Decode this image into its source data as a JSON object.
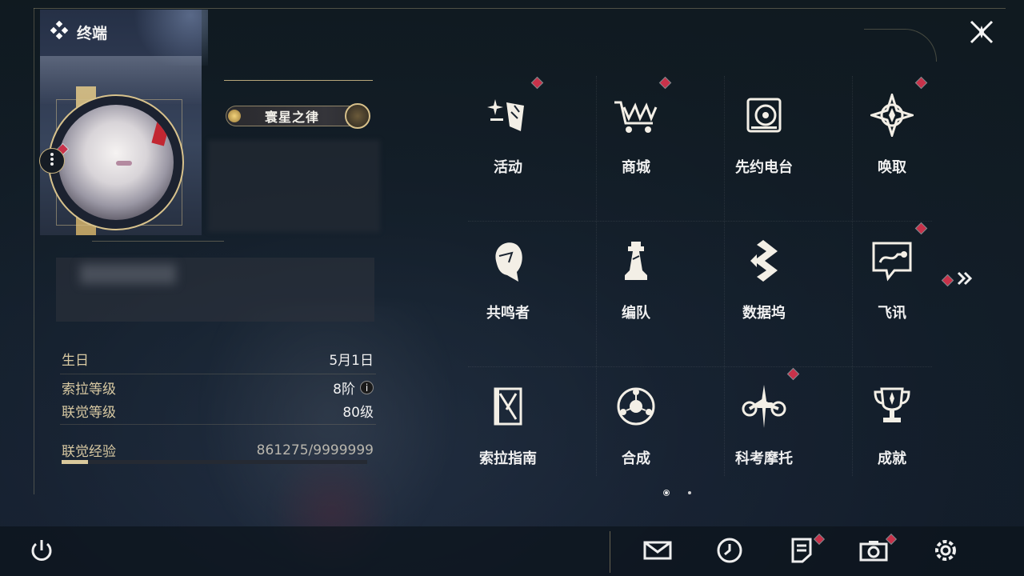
{
  "header": {
    "title": "终端",
    "title_icon": "diamond-cluster-icon",
    "close_icon": "close-icon"
  },
  "profile": {
    "player_name": "寰星之律",
    "more_icon": "more-dots-icon",
    "stats": [
      {
        "label": "生日",
        "value": "5月1日"
      },
      {
        "label": "索拉等级",
        "value": "8阶",
        "info": "i"
      },
      {
        "label": "联觉等级",
        "value": "80级"
      },
      {
        "label": "联觉经验",
        "value": "861275/9999999"
      }
    ],
    "exp_progress": 0.086
  },
  "menu": {
    "items": [
      {
        "label": "活动",
        "icon": "sparkle-flag-icon",
        "notify": true
      },
      {
        "label": "商城",
        "icon": "crown-cart-icon",
        "notify": true
      },
      {
        "label": "先约电台",
        "icon": "radio-disc-icon",
        "notify": false
      },
      {
        "label": "唤取",
        "icon": "compass-star-icon",
        "notify": true
      },
      {
        "label": "共鸣者",
        "icon": "character-head-icon",
        "notify": false
      },
      {
        "label": "编队",
        "icon": "chess-piece-icon",
        "notify": false
      },
      {
        "label": "数据坞",
        "icon": "data-dock-icon",
        "notify": false
      },
      {
        "label": "飞讯",
        "icon": "chat-bubble-icon",
        "notify": true
      },
      {
        "label": "索拉指南",
        "icon": "guide-book-icon",
        "notify": false
      },
      {
        "label": "合成",
        "icon": "synthesis-orb-icon",
        "notify": false
      },
      {
        "label": "科考摩托",
        "icon": "motorbike-icon",
        "notify": true
      },
      {
        "label": "成就",
        "icon": "trophy-icon",
        "notify": false
      }
    ],
    "next_page_icon": "double-chevron-right-icon",
    "pages": 2,
    "current_page": 1
  },
  "bottom_bar": {
    "power_icon": "power-icon",
    "buttons": [
      {
        "icon": "mail-icon",
        "notify": false
      },
      {
        "icon": "clock-icon",
        "notify": false
      },
      {
        "icon": "notice-icon",
        "notify": true
      },
      {
        "icon": "camera-icon",
        "notify": true
      },
      {
        "icon": "settings-gear-icon",
        "notify": false
      }
    ]
  },
  "colors": {
    "accent_gold": "#d8c28c",
    "notify_red": "#c8324a",
    "label_gold": "#d8c9a2"
  }
}
